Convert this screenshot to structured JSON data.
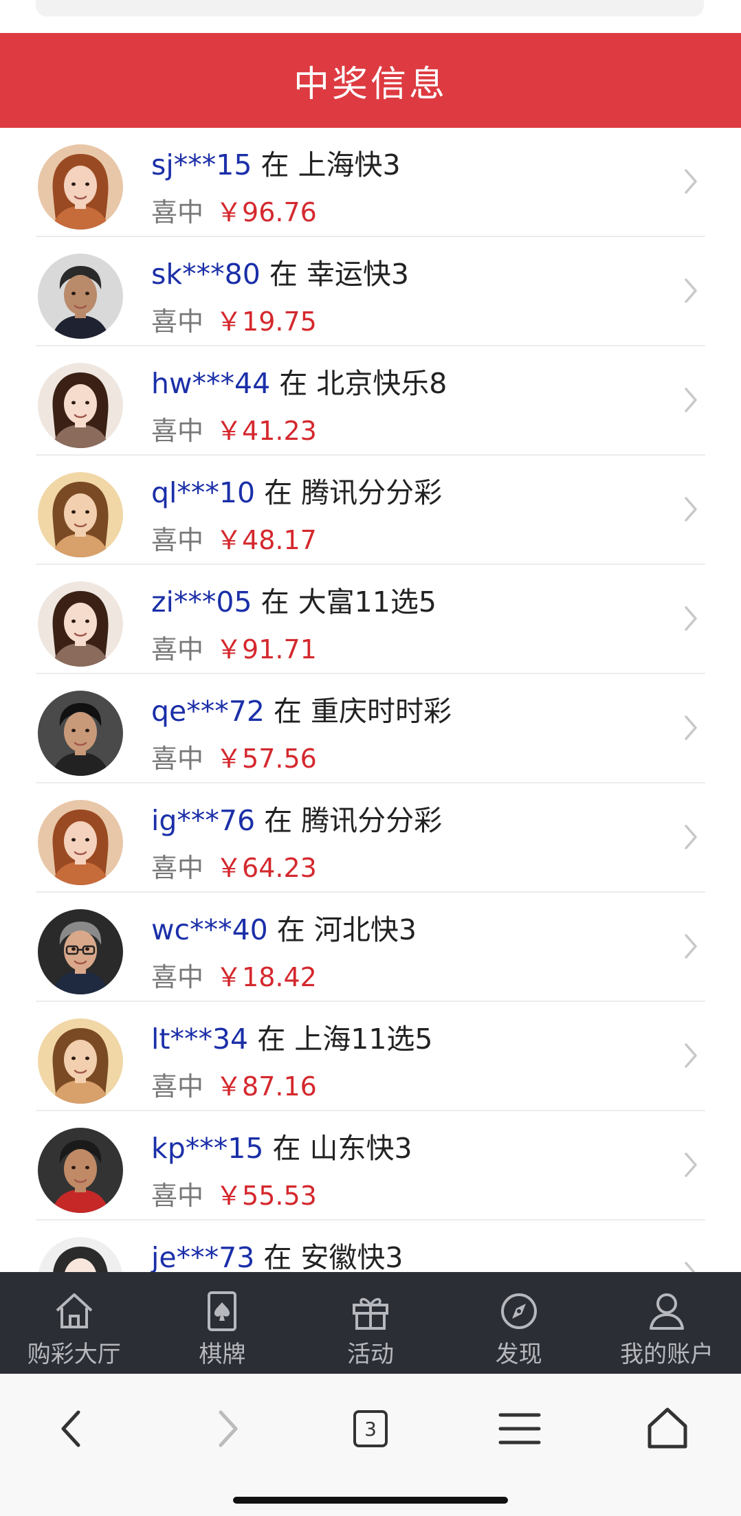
{
  "header": {
    "title": "中奖信息"
  },
  "winners": [
    {
      "user": "sj***15",
      "game": "上海快3",
      "amount": "￥96.76",
      "avatar": "avatar-woman-auburn"
    },
    {
      "user": "sk***80",
      "game": "幸运快3",
      "amount": "￥19.75",
      "avatar": "avatar-man-beard"
    },
    {
      "user": "hw***44",
      "game": "北京快乐8",
      "amount": "￥41.23",
      "avatar": "avatar-woman-bob"
    },
    {
      "user": "ql***10",
      "game": "腾讯分分彩",
      "amount": "￥48.17",
      "avatar": "avatar-woman-smile"
    },
    {
      "user": "zi***05",
      "game": "大富11选5",
      "amount": "￥91.71",
      "avatar": "avatar-woman-bob"
    },
    {
      "user": "qe***72",
      "game": "重庆时时彩",
      "amount": "￥57.56",
      "avatar": "avatar-man-dark"
    },
    {
      "user": "ig***76",
      "game": "腾讯分分彩",
      "amount": "￥64.23",
      "avatar": "avatar-woman-auburn"
    },
    {
      "user": "wc***40",
      "game": "河北快3",
      "amount": "￥18.42",
      "avatar": "avatar-man-glasses"
    },
    {
      "user": "lt***34",
      "game": "上海11选5",
      "amount": "￥87.16",
      "avatar": "avatar-woman-smile"
    },
    {
      "user": "kp***15",
      "game": "山东快3",
      "amount": "￥55.53",
      "avatar": "avatar-man-red-shirt"
    },
    {
      "user": "je***73",
      "game": "安徽快3",
      "amount": "",
      "avatar": "avatar-woman-pale"
    }
  ],
  "labels": {
    "at": "在",
    "won": "喜中"
  },
  "tabbar": [
    {
      "label": "购彩大厅",
      "icon": "house-icon"
    },
    {
      "label": "棋牌",
      "icon": "card-icon"
    },
    {
      "label": "活动",
      "icon": "gift-icon"
    },
    {
      "label": "发现",
      "icon": "compass-icon"
    },
    {
      "label": "我的账户",
      "icon": "user-icon"
    }
  ],
  "browser": {
    "tab_count": "3"
  },
  "colors": {
    "header": "#dd3b41",
    "username": "#1b2fa8",
    "amount": "#d4282d",
    "tabbar": "#2c2e35"
  }
}
